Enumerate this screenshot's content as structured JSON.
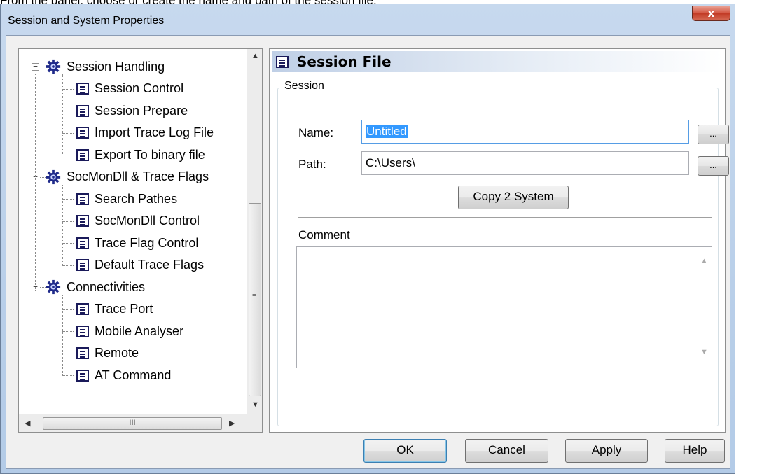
{
  "caption": "From the panel, choose or create the name and path of the session file.",
  "window": {
    "title": "Session and System Properties",
    "close_glyph": "x"
  },
  "tree": {
    "groups": [
      {
        "label": "Session Handling",
        "items": [
          "Session Control",
          "Session Prepare",
          "Import Trace Log File",
          "Export To binary file"
        ]
      },
      {
        "label": "SocMonDll & Trace Flags",
        "items": [
          "Search Pathes",
          "SocMonDll Control",
          "Trace Flag Control",
          "Default Trace Flags"
        ]
      },
      {
        "label": "Connectivities",
        "items": [
          "Trace Port",
          "Mobile Analyser",
          "Remote",
          "AT Command"
        ]
      }
    ],
    "expander_glyph": "−",
    "hscroll_grip": "III"
  },
  "panel": {
    "header_title": "Session File",
    "group_title": "Session",
    "name_label": "Name:",
    "name_value": "Untitled",
    "path_label": "Path:",
    "path_value": "C:\\Users\\",
    "browse_label": "...",
    "copy_button": "Copy 2 System",
    "comment_label": "Comment",
    "comment_value": ""
  },
  "buttons": {
    "ok": "OK",
    "cancel": "Cancel",
    "apply": "Apply",
    "help": "Help"
  },
  "icons": {
    "group_icon": "gear-icon",
    "item_icon": "document-icon"
  },
  "colors": {
    "title_gradient": "#c7d9ee",
    "close_button": "#c23a25",
    "selection": "#3399ff",
    "tree_icon": "#1a1a5a"
  }
}
